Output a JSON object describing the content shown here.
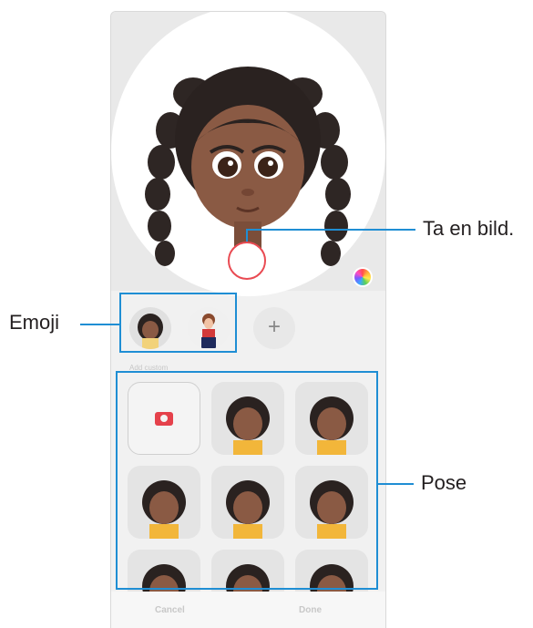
{
  "annotations": {
    "capture": "Ta en bild.",
    "emoji": "Emoji",
    "pose": "Pose"
  },
  "emoji_bar": {
    "add_label": "+"
  },
  "poses": {
    "section_label": "Add custom"
  },
  "footer": {
    "cancel_label": "Cancel",
    "done_label": "Done"
  },
  "colors": {
    "accent": "#1f8ed4",
    "capture_ring": "#e94a52",
    "camera_icon": "#e5414b"
  }
}
